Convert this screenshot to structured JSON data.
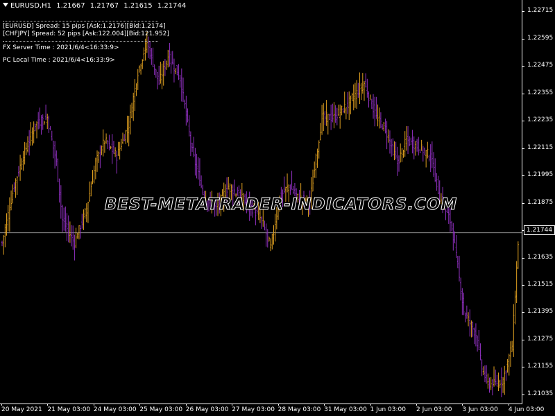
{
  "header": {
    "symbol": "EURUSD,H1",
    "open": "1.21667",
    "high": "1.21767",
    "low": "1.21615",
    "close": "1.21744"
  },
  "spread_panel": {
    "line1": "[EURUSD] Spread: 15 pips [Ask:1.2176][Bid:1.2174]",
    "line2": "[CHFJPY] Spread: 52 pips [Ask:122.004][Bid:121.952]"
  },
  "fx_server_time": "FX Server Time : 2021/6/4<16:33:9>",
  "pc_local_time": "PC Local Time : 2021/6/4<16:33:9>",
  "watermark": "BEST-METATRADER-INDICATORS.COM",
  "current_price": "1.21744",
  "colors": {
    "background": "#000000",
    "bull_bar": "#e0a020",
    "bear_bar": "#9030c0",
    "axis": "#ffffff",
    "price_line": "#c0c0c0"
  },
  "chart_data": {
    "type": "bar",
    "price_levels": [
      "1.22715",
      "1.22595",
      "1.22475",
      "1.22355",
      "1.22235",
      "1.22115",
      "1.21995",
      "1.21875",
      "1.21755",
      "1.21635",
      "1.21515",
      "1.21395",
      "1.21275",
      "1.21155",
      "1.21035"
    ],
    "time_labels": [
      "20 May 2021",
      "21 May 03:00",
      "24 May 03:00",
      "25 May 03:00",
      "26 May 03:00",
      "27 May 03:00",
      "28 May 03:00",
      "31 May 03:00",
      "1 Jun 03:00",
      "2 Jun 03:00",
      "3 Jun 03:00",
      "4 Jun 03:00"
    ],
    "ylim": [
      1.20995,
      1.22765
    ],
    "current_price": 1.21744,
    "anchors": [
      [
        0,
        1.217
      ],
      [
        8,
        1.2195
      ],
      [
        14,
        1.2208
      ],
      [
        22,
        1.2222
      ],
      [
        30,
        1.2225
      ],
      [
        36,
        1.2205
      ],
      [
        40,
        1.218
      ],
      [
        48,
        1.217
      ],
      [
        56,
        1.2185
      ],
      [
        62,
        1.2205
      ],
      [
        68,
        1.2215
      ],
      [
        76,
        1.2208
      ],
      [
        84,
        1.2222
      ],
      [
        90,
        1.2245
      ],
      [
        96,
        1.2258
      ],
      [
        104,
        1.224
      ],
      [
        110,
        1.2252
      ],
      [
        118,
        1.2242
      ],
      [
        126,
        1.221
      ],
      [
        134,
        1.219
      ],
      [
        142,
        1.2185
      ],
      [
        150,
        1.2195
      ],
      [
        158,
        1.219
      ],
      [
        166,
        1.2185
      ],
      [
        172,
        1.218
      ],
      [
        178,
        1.2168
      ],
      [
        184,
        1.219
      ],
      [
        190,
        1.2195
      ],
      [
        196,
        1.219
      ],
      [
        204,
        1.2188
      ],
      [
        212,
        1.2225
      ],
      [
        220,
        1.2225
      ],
      [
        228,
        1.223
      ],
      [
        234,
        1.2235
      ],
      [
        240,
        1.224
      ],
      [
        248,
        1.2225
      ],
      [
        254,
        1.222
      ],
      [
        262,
        1.2205
      ],
      [
        268,
        1.2215
      ],
      [
        276,
        1.2212
      ],
      [
        284,
        1.2208
      ],
      [
        290,
        1.219
      ],
      [
        298,
        1.2178
      ],
      [
        306,
        1.214
      ],
      [
        314,
        1.213
      ],
      [
        318,
        1.2115
      ],
      [
        322,
        1.2108
      ],
      [
        326,
        1.2108
      ],
      [
        332,
        1.211
      ],
      [
        338,
        1.2125
      ],
      [
        342,
        1.217
      ]
    ]
  }
}
